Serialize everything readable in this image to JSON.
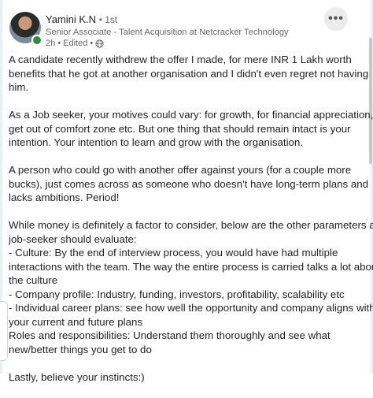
{
  "author": {
    "name": "Yamini K.N",
    "degree": "• 1st",
    "headline": "Senior Associate - Talent Acquisition at Netcracker Technology",
    "time": "2h",
    "edited": "• Edited •",
    "visibility_icon": "globe-icon",
    "status_color": "#2e8b3e"
  },
  "actions": {
    "more_label": "•••"
  },
  "post": {
    "paragraphs": [
      [
        "A candidate recently withdrew the offer I made, for mere INR 1 Lakh worth",
        "benefits that he got at another organisation and I didn't even regret not having",
        "him."
      ],
      [
        "As a Job seeker, your motives could vary: for growth, for financial appreciation, to",
        "get out of comfort zone etc. But one thing that should remain intact is your",
        "intention. Your intention to learn and grow with the organisation."
      ],
      [
        "A person who could go with another offer against yours (for a couple more",
        "bucks), just comes across as someone who doesn't have long-term plans and",
        "lacks ambitions. Period!"
      ],
      [
        "While money is definitely a factor to consider, below are the other parameters a",
        "job-seeker should evaluate:",
        "- Culture: By the end of interview process, you would have had multiple",
        "interactions with the team. The way the entire process is carried talks a lot about",
        "the culture",
        "- Company profile: Industry, funding, investors, profitability, scalability etc",
        "- Individual career plans: see how well the opportunity and company aligns with",
        "your current and future plans",
        "Roles and responsibilities: Understand them thoroughly and see what",
        "new/better things you get to do"
      ],
      [
        "Lastly, believe your instincts:)"
      ]
    ]
  }
}
